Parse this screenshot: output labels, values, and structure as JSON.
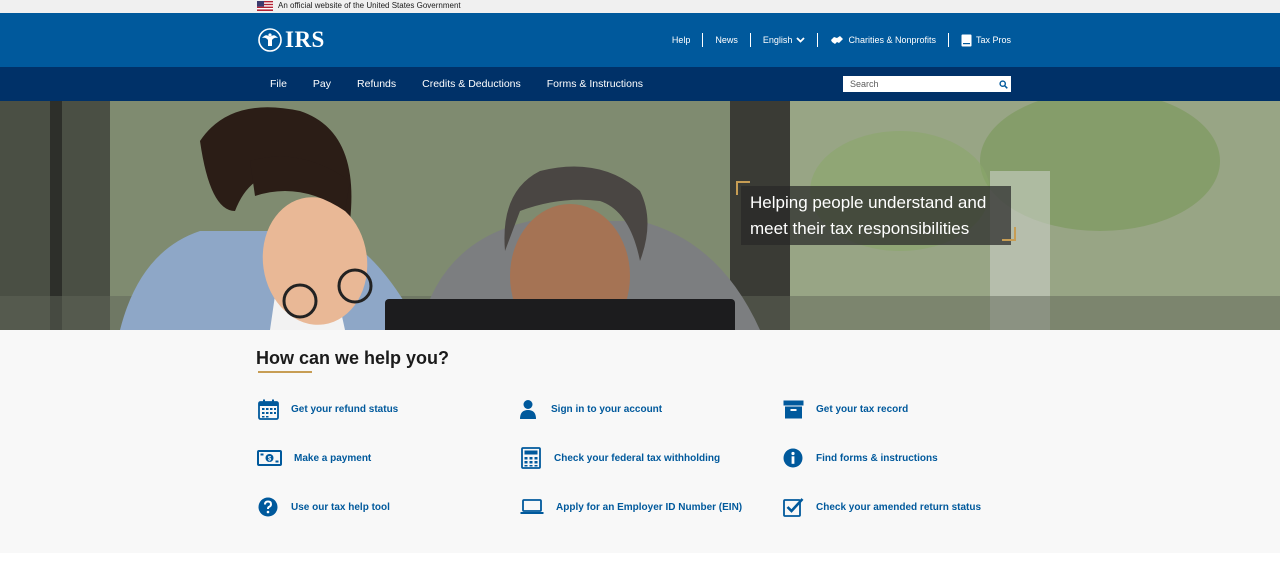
{
  "gov_banner": {
    "text": "An official website of the United States Government"
  },
  "header": {
    "logo_text": "IRS",
    "utility": [
      {
        "label": "Help"
      },
      {
        "label": "News"
      },
      {
        "label": "English"
      },
      {
        "label": "Charities & Nonprofits"
      },
      {
        "label": "Tax Pros"
      }
    ]
  },
  "nav": {
    "items": [
      {
        "label": "File"
      },
      {
        "label": "Pay"
      },
      {
        "label": "Refunds"
      },
      {
        "label": "Credits & Deductions"
      },
      {
        "label": "Forms & Instructions"
      }
    ],
    "search_placeholder": "Search"
  },
  "hero": {
    "line1": "Helping people understand and",
    "line2": "meet their tax responsibilities"
  },
  "help": {
    "title": "How can we help you?",
    "items": [
      {
        "label": "Get your refund status",
        "icon": "calendar-icon"
      },
      {
        "label": "Sign in to your account",
        "icon": "user-icon"
      },
      {
        "label": "Get your tax record",
        "icon": "archive-box-icon"
      },
      {
        "label": "Make a payment",
        "icon": "money-icon"
      },
      {
        "label": "Check your federal tax withholding",
        "icon": "calculator-icon"
      },
      {
        "label": "Find forms & instructions",
        "icon": "info-icon"
      },
      {
        "label": "Use our tax help tool",
        "icon": "question-icon"
      },
      {
        "label": "Apply for an Employer ID Number (EIN)",
        "icon": "laptop-icon"
      },
      {
        "label": "Check your amended return status",
        "icon": "checkbox-icon"
      }
    ]
  },
  "colors": {
    "primary": "#00599c",
    "nav": "#003168",
    "accent": "#c79d54"
  }
}
